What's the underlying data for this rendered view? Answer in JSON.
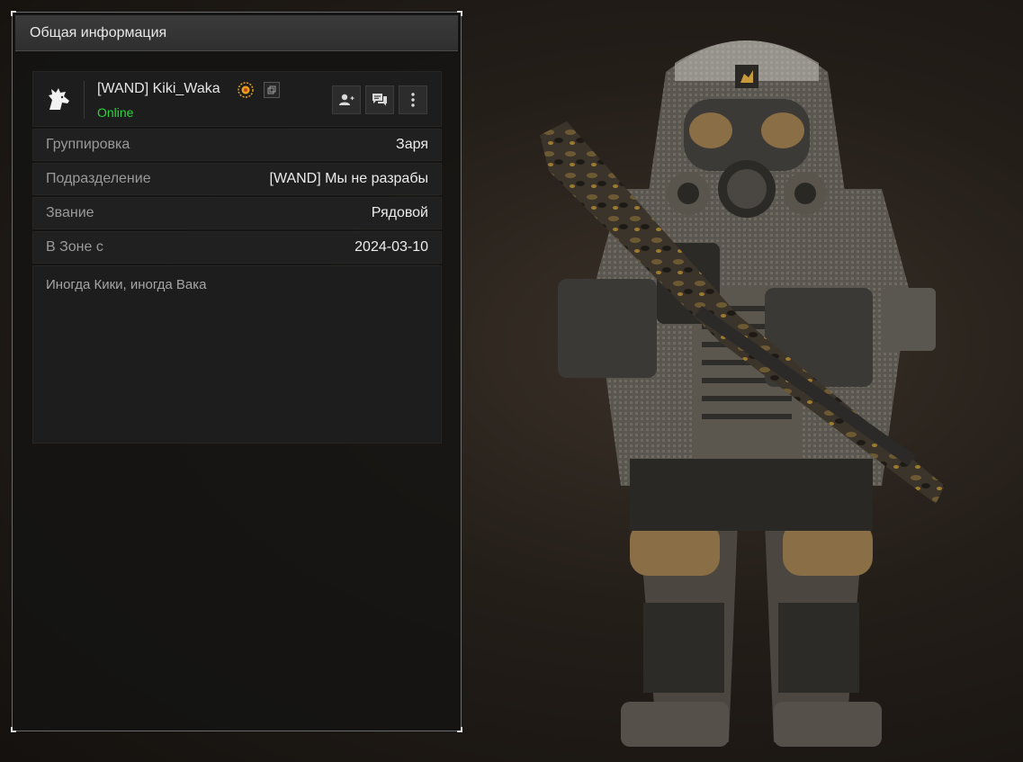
{
  "panel": {
    "title": "Общая информация"
  },
  "profile": {
    "name": "[WAND] Kiki_Waka",
    "status": "Online",
    "avatar_icon": "wolf-head-icon",
    "badge_icon": "sun-badge-icon",
    "actions": [
      {
        "icon": "add-friend-icon"
      },
      {
        "icon": "chat-icon"
      },
      {
        "icon": "more-vertical-icon"
      }
    ]
  },
  "details": [
    {
      "label": "Группировка",
      "value": "Заря"
    },
    {
      "label": "Подразделение",
      "value": "[WAND] Мы не разрабы"
    },
    {
      "label": "Звание",
      "value": "Рядовой"
    },
    {
      "label": "В Зоне с",
      "value": "2024-03-10"
    }
  ],
  "about": "Иногда Кики, иногда Вака",
  "colors": {
    "status_online": "#2fd33a",
    "badge": "#e8a21a",
    "panel_bg": "#141312"
  }
}
